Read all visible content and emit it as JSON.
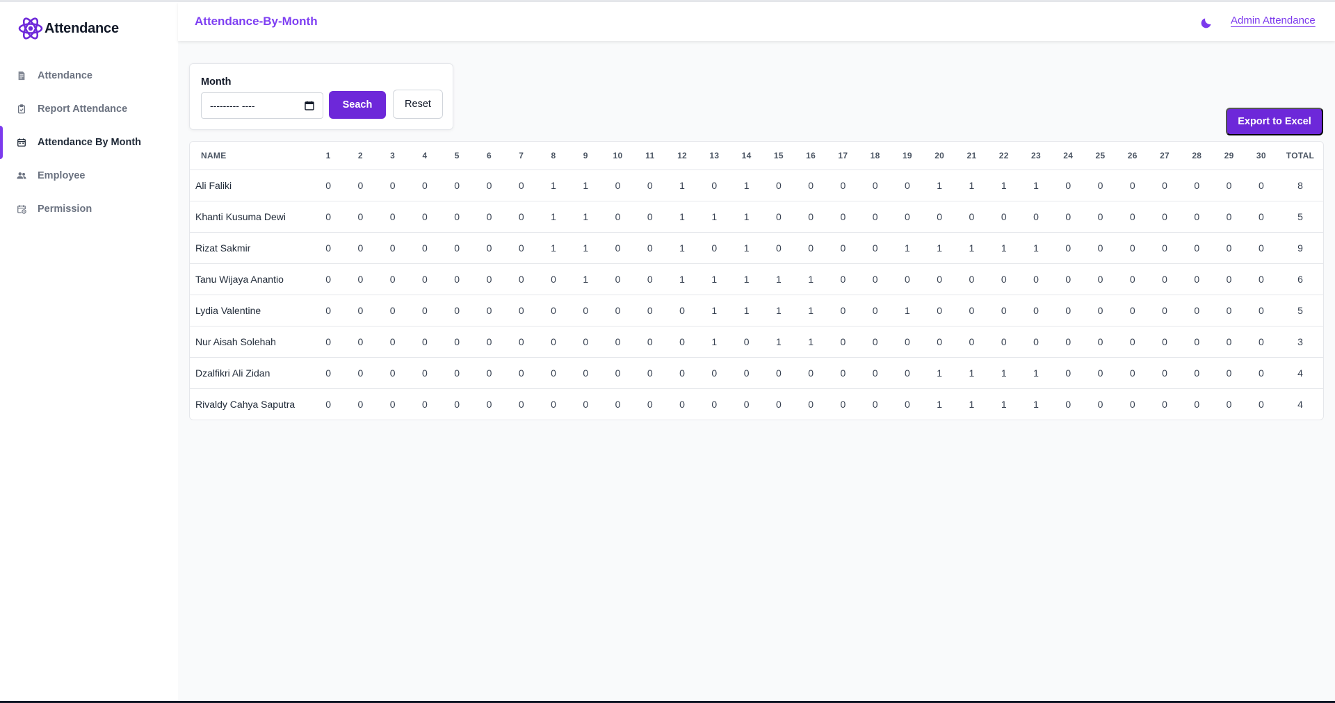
{
  "app": {
    "brand": "Attendance"
  },
  "colors": {
    "accent": "#6d28d9",
    "title": "#7e3ff2"
  },
  "sidebar": {
    "items": [
      {
        "label": "Attendance",
        "icon": "document-icon"
      },
      {
        "label": "Report Attendance",
        "icon": "clipboard-icon"
      },
      {
        "label": "Attendance By Month",
        "icon": "calendar-icon",
        "active": true
      },
      {
        "label": "Employee",
        "icon": "users-icon"
      },
      {
        "label": "Permission",
        "icon": "calendar-clock-icon"
      }
    ]
  },
  "header": {
    "title": "Attendance-By-Month",
    "theme_icon": "moon-icon",
    "user_link": "Admin Attendance"
  },
  "filter": {
    "label": "Month",
    "placeholder": "--------- ----",
    "search_label": "Seach",
    "reset_label": "Reset"
  },
  "export_label": "Export to Excel",
  "table": {
    "headers": [
      "NAME",
      "1",
      "2",
      "3",
      "4",
      "5",
      "6",
      "7",
      "8",
      "9",
      "10",
      "11",
      "12",
      "13",
      "14",
      "15",
      "16",
      "17",
      "18",
      "19",
      "20",
      "21",
      "22",
      "23",
      "24",
      "25",
      "26",
      "27",
      "28",
      "29",
      "30",
      "TOTAL"
    ],
    "rows": [
      {
        "name": "Ali Faliki",
        "days": [
          0,
          0,
          0,
          0,
          0,
          0,
          0,
          1,
          1,
          0,
          0,
          1,
          0,
          1,
          0,
          0,
          0,
          0,
          0,
          1,
          1,
          1,
          1,
          0,
          0,
          0,
          0,
          0,
          0,
          0
        ],
        "total": 8
      },
      {
        "name": "Khanti Kusuma Dewi",
        "days": [
          0,
          0,
          0,
          0,
          0,
          0,
          0,
          1,
          1,
          0,
          0,
          1,
          1,
          1,
          0,
          0,
          0,
          0,
          0,
          0,
          0,
          0,
          0,
          0,
          0,
          0,
          0,
          0,
          0,
          0
        ],
        "total": 5
      },
      {
        "name": "Rizat Sakmir",
        "days": [
          0,
          0,
          0,
          0,
          0,
          0,
          0,
          1,
          1,
          0,
          0,
          1,
          0,
          1,
          0,
          0,
          0,
          0,
          1,
          1,
          1,
          1,
          1,
          0,
          0,
          0,
          0,
          0,
          0,
          0
        ],
        "total": 9
      },
      {
        "name": "Tanu Wijaya Anantio",
        "days": [
          0,
          0,
          0,
          0,
          0,
          0,
          0,
          0,
          1,
          0,
          0,
          1,
          1,
          1,
          1,
          1,
          0,
          0,
          0,
          0,
          0,
          0,
          0,
          0,
          0,
          0,
          0,
          0,
          0,
          0
        ],
        "total": 6
      },
      {
        "name": "Lydia Valentine",
        "days": [
          0,
          0,
          0,
          0,
          0,
          0,
          0,
          0,
          0,
          0,
          0,
          0,
          1,
          1,
          1,
          1,
          0,
          0,
          1,
          0,
          0,
          0,
          0,
          0,
          0,
          0,
          0,
          0,
          0,
          0
        ],
        "total": 5
      },
      {
        "name": "Nur Aisah Solehah",
        "days": [
          0,
          0,
          0,
          0,
          0,
          0,
          0,
          0,
          0,
          0,
          0,
          0,
          1,
          0,
          1,
          1,
          0,
          0,
          0,
          0,
          0,
          0,
          0,
          0,
          0,
          0,
          0,
          0,
          0,
          0
        ],
        "total": 3
      },
      {
        "name": "Dzalfikri Ali Zidan",
        "days": [
          0,
          0,
          0,
          0,
          0,
          0,
          0,
          0,
          0,
          0,
          0,
          0,
          0,
          0,
          0,
          0,
          0,
          0,
          0,
          1,
          1,
          1,
          1,
          0,
          0,
          0,
          0,
          0,
          0,
          0
        ],
        "total": 4
      },
      {
        "name": "Rivaldy Cahya Saputra",
        "days": [
          0,
          0,
          0,
          0,
          0,
          0,
          0,
          0,
          0,
          0,
          0,
          0,
          0,
          0,
          0,
          0,
          0,
          0,
          0,
          1,
          1,
          1,
          1,
          0,
          0,
          0,
          0,
          0,
          0,
          0
        ],
        "total": 4
      }
    ]
  }
}
